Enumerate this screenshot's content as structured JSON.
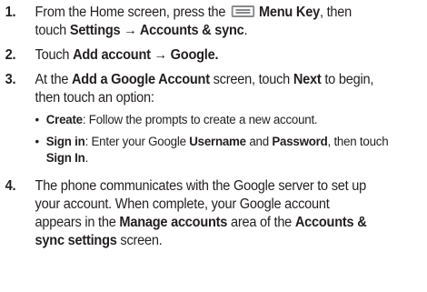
{
  "steps": [
    {
      "number": "1.",
      "line1_pre": "From the Home screen, press the",
      "icon": "menu-key-icon",
      "line1_key": "Menu Key",
      "line1_post": ", then",
      "line2_pre": "touch",
      "line2_bold": "Settings → Accounts & sync",
      "line2_post": "."
    },
    {
      "number": "2.",
      "pre": "Touch",
      "bold": "Add account → Google."
    },
    {
      "number": "3.",
      "pre": "At the",
      "bold1": "Add a Google Account",
      "mid": "screen, touch",
      "bold2": "Next",
      "post": "to begin,",
      "line2": "then touch an option:",
      "bullets": [
        {
          "dot": "•",
          "term": "Create",
          "text": ": Follow the prompts to create a new account."
        },
        {
          "dot": "•",
          "term": "Sign in",
          "text1": ": Enter your Google",
          "bold_a": "Username",
          "and": "and",
          "bold_b": "Password",
          "text2": ", then touch",
          "bold_c": "Sign In",
          "end": "."
        }
      ]
    },
    {
      "number": "4.",
      "line1": "The phone communicates with the Google server to set up",
      "line2": "your account. When complete, your Google account",
      "line3_pre": "appears in the",
      "line3_bold1": "Manage accounts",
      "line3_mid": "area of the",
      "line3_bold2": "Accounts &",
      "line4_bold": "sync settings",
      "line4_post": "screen."
    }
  ]
}
